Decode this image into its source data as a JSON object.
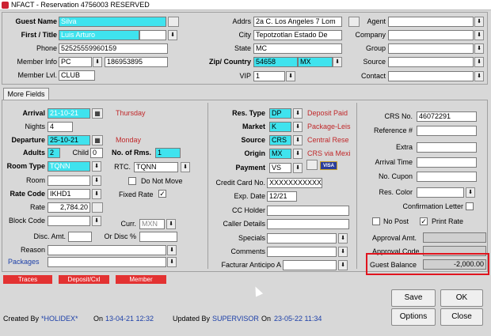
{
  "window": {
    "title": "NFACT - Reservation 4756003  RESERVED"
  },
  "guest": {
    "name_label": "Guest Name",
    "name": "Silva",
    "first_title_label": "First / Title",
    "first_title": "Luis Arturo",
    "phone_label": "Phone",
    "phone": "52525559960159",
    "member_info_label": "Member Info",
    "member_info_type": "PC",
    "member_info_number": "186953895",
    "member_lvl_label": "Member Lvl.",
    "member_lvl": "CLUB"
  },
  "address": {
    "addrs_label": "Addrs",
    "addrs": "2a C. Los Angeles 7 Lom",
    "city_label": "City",
    "city": "Tepotzotlan Estado De",
    "state_label": "State",
    "state": "MC",
    "zip_country_label": "Zip/ Country",
    "zip": "54658",
    "country": "MX",
    "vip_label": "VIP",
    "vip": "1"
  },
  "contacts": {
    "agent_label": "Agent",
    "company_label": "Company",
    "group_label": "Group",
    "source_label": "Source",
    "contact_label": "Contact"
  },
  "more_fields_tab": "More Fields",
  "stay": {
    "arrival_label": "Arrival",
    "arrival": "21-10-21",
    "arrival_day": "Thursday",
    "nights_label": "Nights",
    "nights": "4",
    "departure_label": "Departure",
    "departure": "25-10-21",
    "departure_day": "Monday",
    "adults_label": "Adults",
    "adults": "2",
    "child_label": "Child",
    "child": "0",
    "rooms_label": "No. of Rms.",
    "rooms": "1",
    "room_type_label": "Room Type",
    "room_type": "TQNN",
    "rtc_label": "RTC.",
    "rtc": "TQNN",
    "room_label": "Room",
    "do_not_move_label": "Do Not Move",
    "rate_code_label": "Rate Code",
    "rate_code": "IKHD1",
    "fixed_rate_label": "Fixed Rate",
    "rate_label": "Rate",
    "rate": "2,784.20",
    "block_code_label": "Block Code",
    "curr_label": "Curr.",
    "curr": "MXN",
    "disc_amt_label": "Disc. Amt.",
    "or_disc_label": "Or Disc %",
    "reason_label": "Reason",
    "packages_label": "Packages"
  },
  "reservation": {
    "res_type_label": "Res. Type",
    "res_type": "DP",
    "res_type_desc": "Deposit Paid",
    "market_label": "Market",
    "market": "K",
    "market_desc": "Package-Leis",
    "source_label": "Source",
    "source": "CRS",
    "source_desc": "Central Rese",
    "origin_label": "Origin",
    "origin": "MX",
    "origin_desc": "CRS via Mexi",
    "payment_label": "Payment",
    "payment": "VS",
    "card_brand": "VISA",
    "credit_card_label": "Credit Card No.",
    "credit_card": "XXXXXXXXXXXX",
    "exp_date_label": "Exp. Date",
    "exp_date": "12/21",
    "cc_holder_label": "CC Holder",
    "caller_details_label": "Caller Details",
    "specials_label": "Specials",
    "comments_label": "Comments",
    "facturar_label": "Facturar Anticipo A"
  },
  "right_panel": {
    "crs_label": "CRS No.",
    "crs": "46072291",
    "reference_label": "Reference #",
    "extra_label": "Extra",
    "arrival_time_label": "Arrival Time",
    "cupon_label": "No. Cupon",
    "res_color_label": "Res. Color",
    "confirmation_label": "Confirmation Letter",
    "no_post_label": "No Post",
    "print_rate_label": "Print Rate",
    "approval_amt_label": "Approval Amt.",
    "approval_code_label": "Approval Code",
    "guest_balance_label": "Guest Balance",
    "guest_balance": "-2,000.00"
  },
  "bottom_tabs": {
    "traces": "Traces",
    "deposit": "Deposit/Cxl",
    "member": "Member"
  },
  "footer": {
    "created_by_label": "Created By",
    "created_by": "*HOLIDEX*",
    "on_label": "On",
    "created_on": "13-04-21 12:32",
    "updated_by_label": "Updated By",
    "updated_by": "SUPERVISOR",
    "on_label2": "On",
    "updated_on": "23-05-22 11:34"
  },
  "buttons": {
    "save": "Save",
    "ok": "OK",
    "options": "Options",
    "close": "Close"
  },
  "highlight_color": "#e0141e",
  "accent_cyan": "#3fe3ee"
}
